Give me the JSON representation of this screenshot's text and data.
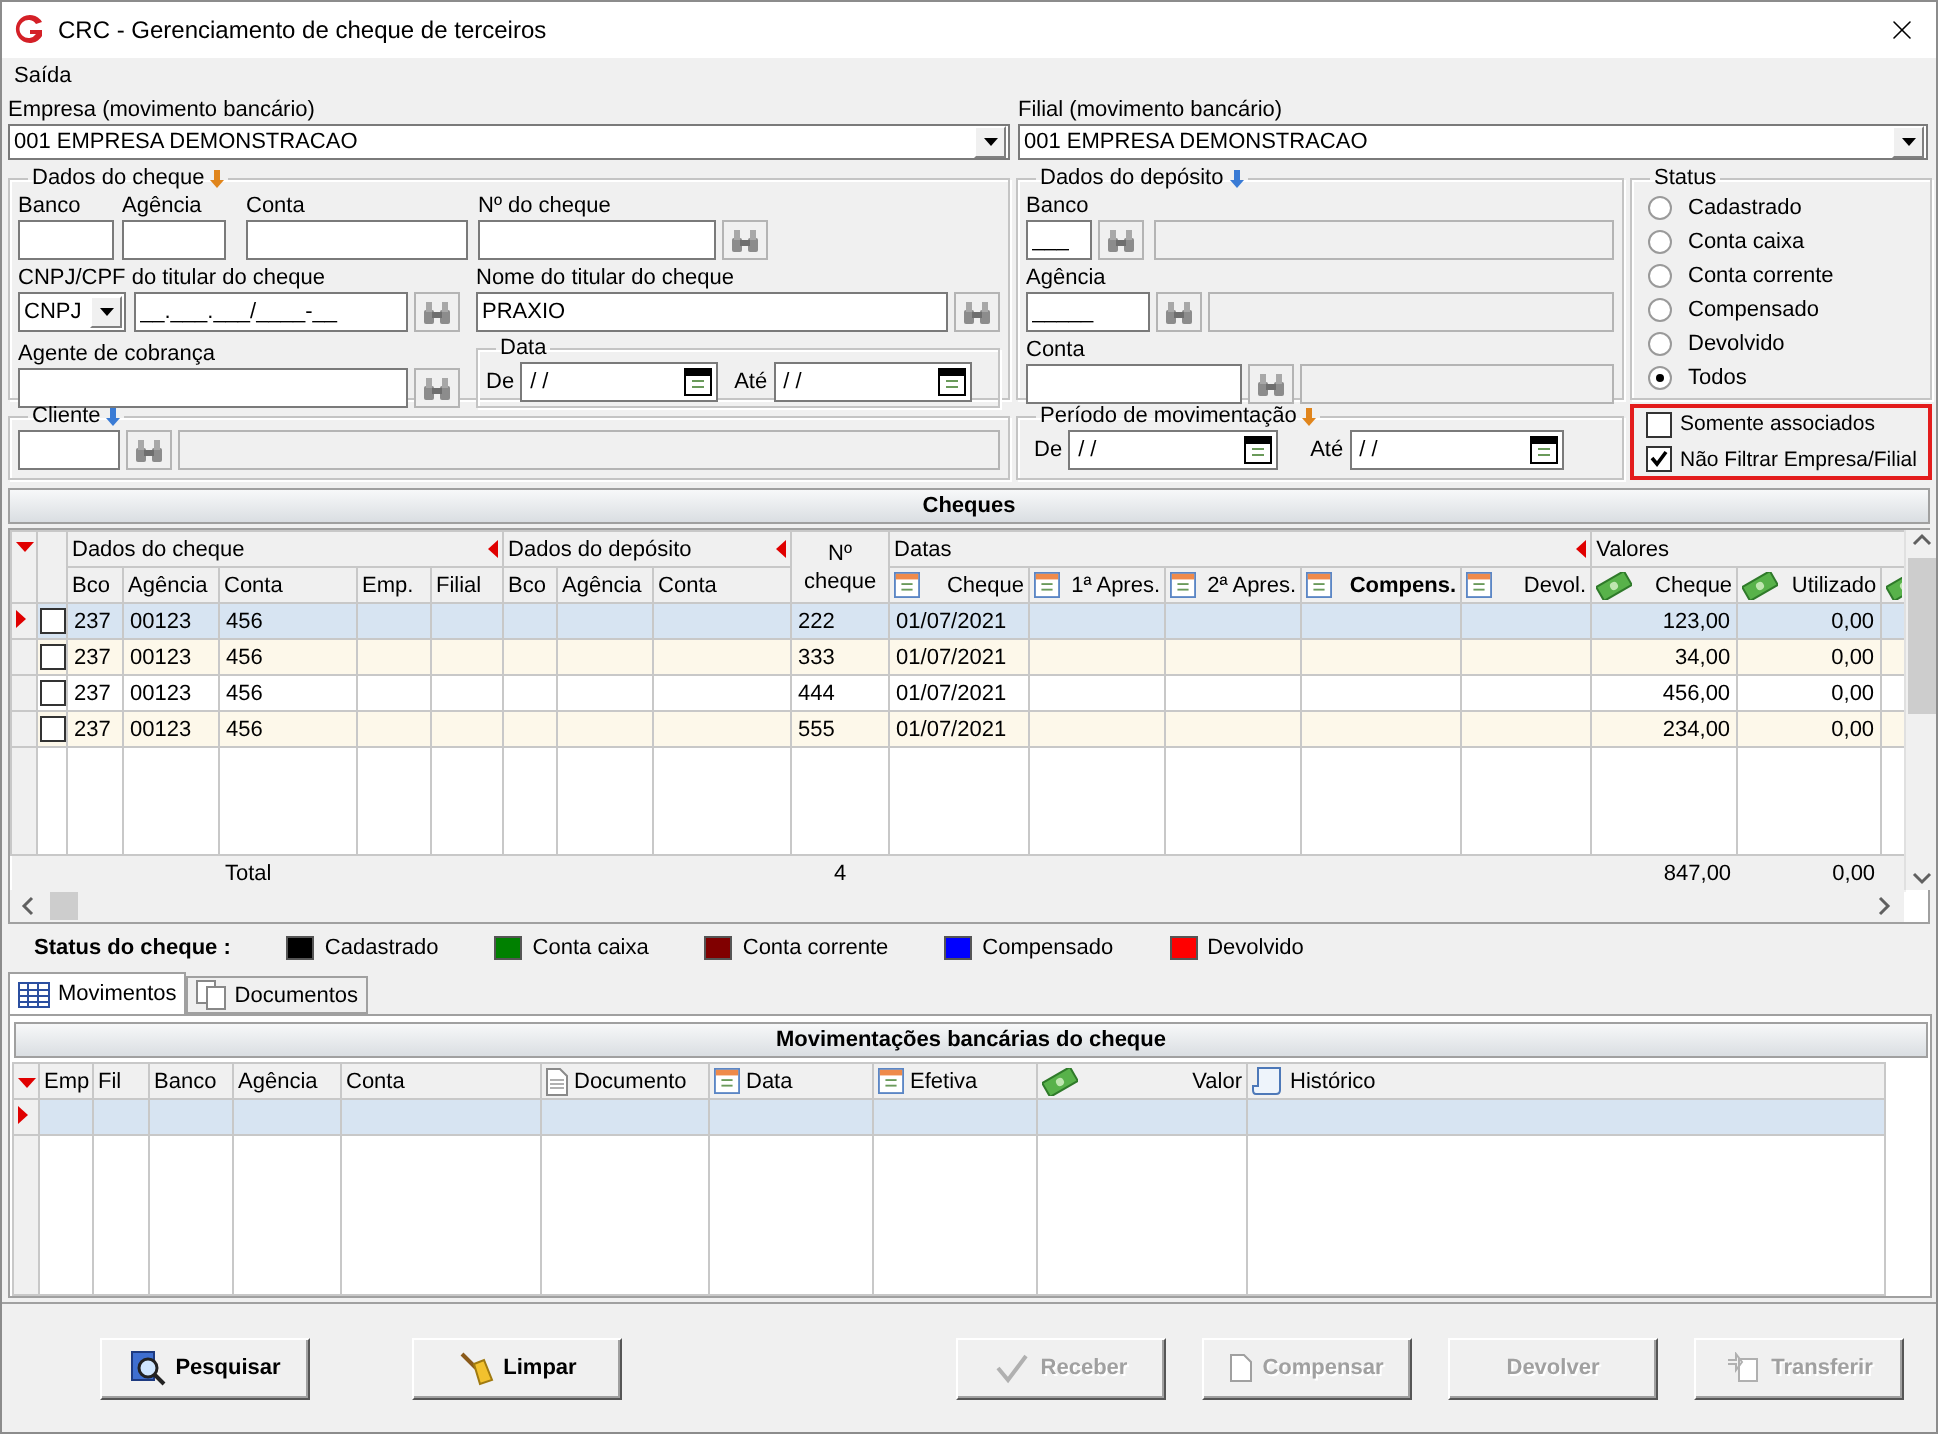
{
  "window": {
    "title": "CRC - Gerenciamento de cheque de terceiros"
  },
  "menu": [
    "Saída"
  ],
  "empresa": {
    "label": "Empresa (movimento bancário)",
    "value": "001 EMPRESA DEMONSTRACAO"
  },
  "filial": {
    "label": "Filial (movimento bancário)",
    "value": "001 EMPRESA DEMONSTRACAO"
  },
  "dados_cheque": {
    "title": "Dados do cheque",
    "banco_label": "Banco",
    "agencia_label": "Agência",
    "conta_label": "Conta",
    "numero_label": "Nº do cheque",
    "doc_label": "CNPJ/CPF do titular do cheque",
    "doc_type": "CNPJ",
    "doc_value": "__.___.___/____-__",
    "nome_label": "Nome do titular do cheque",
    "nome_value": "PRAXIO",
    "agente_label": "Agente de cobrança",
    "data": {
      "title": "Data",
      "de_label": "De",
      "de_value": "/ /",
      "ate_label": "Até",
      "ate_value": "/ /"
    }
  },
  "cliente": {
    "title": "Cliente"
  },
  "dados_deposito": {
    "title": "Dados do depósito",
    "banco_label": "Banco",
    "banco_value": "___",
    "agencia_label": "Agência",
    "agencia_value": "_____",
    "conta_label": "Conta"
  },
  "periodo": {
    "title": "Período de movimentação",
    "de_label": "De",
    "de_value": "/ /",
    "ate_label": "Até",
    "ate_value": "/ /"
  },
  "status": {
    "title": "Status",
    "options": [
      {
        "label": "Cadastrado",
        "selected": false
      },
      {
        "label": "Conta caixa",
        "selected": false
      },
      {
        "label": "Conta corrente",
        "selected": false
      },
      {
        "label": "Compensado",
        "selected": false
      },
      {
        "label": "Devolvido",
        "selected": false
      },
      {
        "label": "Todos",
        "selected": true
      }
    ]
  },
  "filters": [
    {
      "label": "Somente associados",
      "checked": false
    },
    {
      "label": "Não Filtrar Empresa/Filial",
      "checked": true
    }
  ],
  "cheques": {
    "title": "Cheques",
    "groups": [
      {
        "label": "Dados do cheque",
        "kind": "collapsible",
        "columns": [
          {
            "label": "Bco",
            "sorted": false
          },
          {
            "label": "Agência",
            "sorted": false
          },
          {
            "label": "Conta",
            "sorted": false
          },
          {
            "label": "Emp.",
            "sorted": false
          },
          {
            "label": "Filial",
            "sorted": false
          }
        ]
      },
      {
        "label": "Dados do depósito",
        "kind": "collapsible",
        "columns": [
          {
            "label": "Bco",
            "sorted": false
          },
          {
            "label": "Agência",
            "sorted": false
          },
          {
            "label": "Conta",
            "sorted": false
          }
        ]
      },
      {
        "label": "Nº cheque",
        "kind": "single"
      },
      {
        "label": "Datas",
        "kind": "collapsible",
        "columns": [
          {
            "label": "Cheque",
            "kind": "date",
            "sorted": false
          },
          {
            "label": "1ª Apres.",
            "kind": "date",
            "sorted": false
          },
          {
            "label": "2ª Apres.",
            "kind": "date",
            "sorted": false
          },
          {
            "label": "Compens.",
            "kind": "date",
            "sorted": true
          },
          {
            "label": "Devol.",
            "kind": "date",
            "sorted": false
          }
        ]
      },
      {
        "label": "Valores",
        "kind": "plain",
        "columns": [
          {
            "label": "Cheque",
            "kind": "money",
            "sorted": false
          },
          {
            "label": "Utilizado",
            "kind": "money",
            "sorted": false
          },
          {
            "kind": "money"
          }
        ]
      }
    ],
    "rows": [
      {
        "selected": true,
        "checked": false,
        "cells": [
          "237",
          "00123",
          "456",
          null,
          null,
          null,
          null,
          null,
          "222",
          "01/07/2021",
          null,
          null,
          null,
          null,
          "123,00",
          "0,00"
        ]
      },
      {
        "selected": false,
        "checked": false,
        "cells": [
          "237",
          "00123",
          "456",
          null,
          null,
          null,
          null,
          null,
          "333",
          "01/07/2021",
          null,
          null,
          null,
          null,
          "34,00",
          "0,00"
        ]
      },
      {
        "selected": false,
        "checked": false,
        "cells": [
          "237",
          "00123",
          "456",
          null,
          null,
          null,
          null,
          null,
          "444",
          "01/07/2021",
          null,
          null,
          null,
          null,
          "456,00",
          "0,00"
        ]
      },
      {
        "selected": false,
        "checked": false,
        "cells": [
          "237",
          "00123",
          "456",
          null,
          null,
          null,
          null,
          null,
          "555",
          "01/07/2021",
          null,
          null,
          null,
          null,
          "234,00",
          "0,00"
        ]
      }
    ],
    "total": {
      "label": "Total",
      "count": "4",
      "cheque": "847,00",
      "utilizado": "0,00"
    }
  },
  "legend": {
    "title": "Status do cheque :",
    "items": [
      {
        "label": "Cadastrado",
        "color": "#000000"
      },
      {
        "label": "Conta caixa",
        "color": "#008000"
      },
      {
        "label": "Conta corrente",
        "color": "#800000"
      },
      {
        "label": "Compensado",
        "color": "#0000ff"
      },
      {
        "label": "Devolvido",
        "color": "#ff0000"
      }
    ]
  },
  "tabs": [
    {
      "label": "Movimentos",
      "selected": true
    },
    {
      "label": "Documentos",
      "selected": false
    }
  ],
  "movimentos": {
    "title": "Movimentações bancárias do cheque",
    "columns": [
      {
        "label": "Emp"
      },
      {
        "label": "Fil"
      },
      {
        "label": "Banco"
      },
      {
        "label": "Agência"
      },
      {
        "label": "Conta"
      },
      {
        "label": "Documento",
        "kind": "document"
      },
      {
        "label": "Data",
        "kind": "date"
      },
      {
        "label": "Efetiva",
        "kind": "date"
      },
      {
        "label": "Valor",
        "kind": "money"
      },
      {
        "label": "Histórico",
        "kind": "history"
      }
    ],
    "rows": [
      {
        "selected": true
      }
    ]
  },
  "buttons": [
    {
      "label": "Pesquisar",
      "disabled": false
    },
    {
      "label": "Limpar",
      "disabled": false
    },
    {
      "label": "Receber",
      "disabled": true
    },
    {
      "label": "Compensar",
      "disabled": true
    },
    {
      "label": "Devolver",
      "disabled": true
    },
    {
      "label": "Transferir",
      "disabled": true
    }
  ]
}
